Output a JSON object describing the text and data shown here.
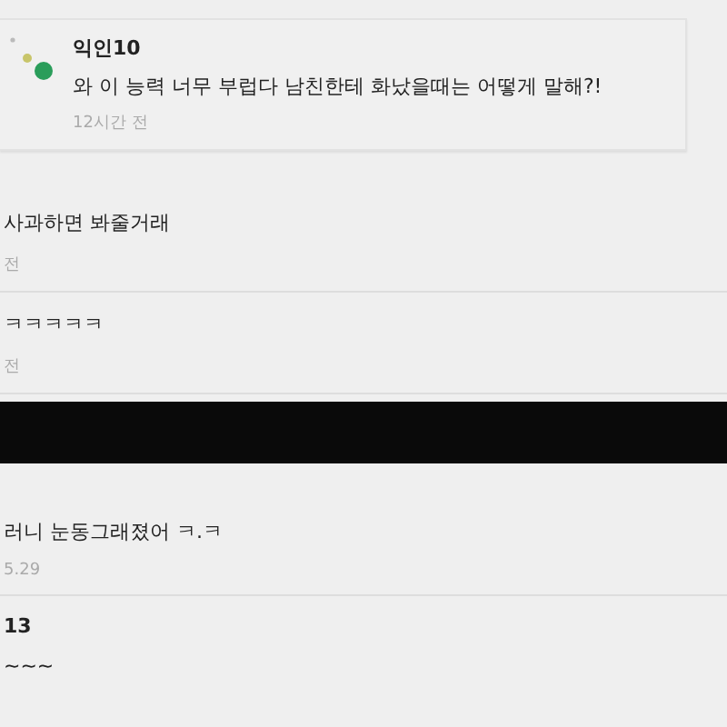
{
  "comments": [
    {
      "kind": "card",
      "author": "익인10",
      "text": "와 이 능력 너무 부럽다 남친한테 화났을때는 어떻게 말해?!",
      "time": "12시간 전"
    },
    {
      "kind": "cut",
      "text": "사과하면 봐줄거래",
      "time": "전"
    },
    {
      "kind": "cut",
      "text": "ㅋㅋㅋㅋㅋ",
      "time": "전"
    },
    {
      "kind": "redacted"
    },
    {
      "kind": "cut",
      "text": "러니 눈동그래졌어 ㅋ.ㅋ",
      "time": "5.29"
    },
    {
      "kind": "cut",
      "author": "13",
      "text": "~~~"
    }
  ]
}
